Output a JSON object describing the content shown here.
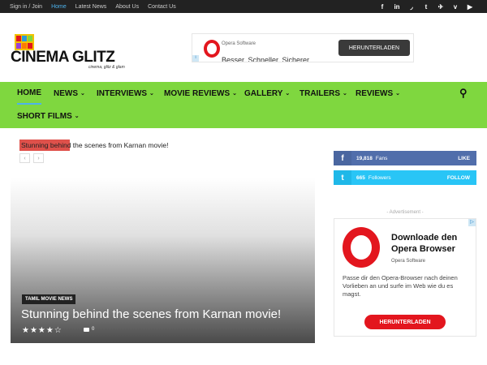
{
  "topbar": {
    "links": [
      {
        "label": "Sign in / Join",
        "active": false
      },
      {
        "label": "Home",
        "active": true
      },
      {
        "label": "Latest News",
        "active": false
      },
      {
        "label": "About Us",
        "active": false
      },
      {
        "label": "Contact Us",
        "active": false
      }
    ],
    "social": [
      "f",
      "in",
      "rss",
      "t",
      "tw",
      "v",
      "yt"
    ]
  },
  "logo": {
    "name": "CINEMA GLITZ",
    "tagline": "cinema, glitz & glam"
  },
  "top_ad": {
    "brand": "Opera Software",
    "slogan": "Besser. Schneller. Sicherer.",
    "button": "HERUNTERLADEN"
  },
  "nav": {
    "items": [
      {
        "label": "HOME",
        "dropdown": false,
        "active": true
      },
      {
        "label": "NEWS",
        "dropdown": true
      },
      {
        "label": "INTERVIEWS",
        "dropdown": true
      },
      {
        "label": "MOVIE REVIEWS",
        "dropdown": true
      },
      {
        "label": "GALLERY",
        "dropdown": true
      },
      {
        "label": "TRAILERS",
        "dropdown": true
      },
      {
        "label": "REVIEWS",
        "dropdown": true
      },
      {
        "label": "SHORT FILMS",
        "dropdown": true
      }
    ],
    "chevron": "⌄",
    "search_icon": "⚲"
  },
  "ticker": {
    "title": "Stunning behind the scenes from Karnan movie!",
    "prev": "‹",
    "next": "›"
  },
  "hero": {
    "category": "TAMIL MOVIE NEWS",
    "title": "Stunning behind the scenes from Karnan movie!",
    "stars": "★★★★☆",
    "comments": "0"
  },
  "social_counters": {
    "facebook": {
      "icon": "f",
      "count": "19,818",
      "label": "Fans",
      "action": "LIKE"
    },
    "twitter": {
      "icon": "t",
      "count": "665",
      "label": "Followers",
      "action": "FOLLOW"
    }
  },
  "side_ad": {
    "label": "- Advertisement -",
    "headline": "Downloade den Opera Browser",
    "brand": "Opera Software",
    "body": "Passe dir den Opera-Browser nach deinen Vorlieben an und surfe im Web wie du es magst.",
    "button": "HERUNTERLADEN"
  },
  "colors": {
    "nav": "#7fd73f",
    "accent": "#4db2ec",
    "facebook": "#516eab",
    "twitter": "#29c5f6",
    "opera": "#e3161e"
  }
}
